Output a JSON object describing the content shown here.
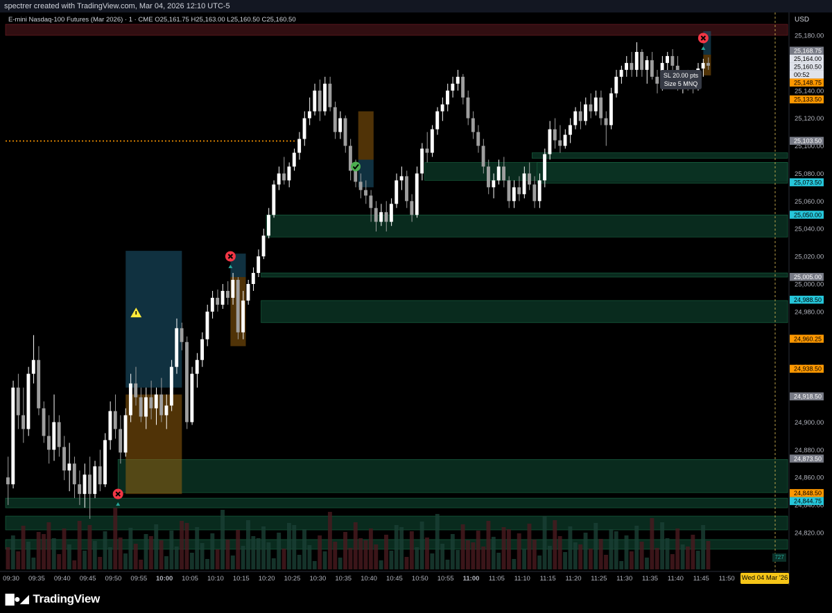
{
  "header": {
    "credit": "spectrer created with TradingView.com, Mar 04, 2026 12:10 UTC-5"
  },
  "symbol": {
    "name": "E-mini Nasdaq-100 Futures (Mar 2026) · 1 · CME",
    "open_label": "O",
    "open": "25,161.75",
    "high_label": "H",
    "high": "25,163.00",
    "low_label": "L",
    "low": "25,160.50",
    "close_label": "C",
    "close": "25,160.50"
  },
  "currency": "USD",
  "footer": {
    "logo": "TradingView",
    "logo_icon": "tradingview-logo-icon"
  },
  "tooltip": {
    "line1": "SL 20.00 pts",
    "line2": "Size 5 MNQ"
  },
  "date_badge": "Wed 04 Mar '26",
  "volume_badge": "727",
  "colors": {
    "up": "#ffffff",
    "down": "#9e9e9e",
    "zone_green": "#0d3b2a",
    "orange": "#ff9800",
    "cyan": "#26c6da",
    "red_marker": "#f23645",
    "green_marker": "#4caf50",
    "warning": "#ffeb3b"
  },
  "chart_data": {
    "type": "candlestick",
    "title": "E-mini Nasdaq-100 Futures (Mar 2026) · 1 · CME",
    "interval": "1 minute",
    "ylim": [
      24810,
      25190
    ],
    "y_ticks": [
      24820,
      24840,
      24860,
      24880,
      24900,
      24920,
      24940,
      24960,
      24980,
      25000,
      25020,
      25040,
      25060,
      25080,
      25100,
      25120,
      25140,
      25160,
      25180
    ],
    "y_tick_labels": [
      "24,820.00",
      "24,840.00",
      "24,860.00",
      "24,880.00",
      "24,900.00",
      "24,920.00",
      "24,940.00",
      "24,960.00",
      "24,980.00",
      "25,000.00",
      "25,020.00",
      "25,040.00",
      "25,060.00",
      "25,080.00",
      "25,100.00",
      "25,120.00",
      "25,140.00",
      "25,160.00",
      "25,180.00"
    ],
    "x_ticks": [
      "09:30",
      "09:35",
      "09:40",
      "09:45",
      "09:50",
      "09:55",
      "10:00",
      "10:05",
      "10:10",
      "10:15",
      "10:20",
      "10:25",
      "10:30",
      "10:35",
      "10:40",
      "10:45",
      "10:50",
      "10:55",
      "11:00",
      "11:05",
      "11:10",
      "11:15",
      "11:20",
      "11:25",
      "11:30",
      "11:35",
      "11:40",
      "11:45",
      "11:50"
    ],
    "bold_x_ticks": [
      "10:00",
      "11:00"
    ],
    "x_range_minutes": [
      0,
      153
    ],
    "price_labels": [
      {
        "text": "25,168.75",
        "value": 25168.75,
        "style": "gray"
      },
      {
        "text": "25,164.00",
        "value": 25164.0,
        "style": "white"
      },
      {
        "text": "25,160.50",
        "value": 25160.5,
        "style": "white"
      },
      {
        "text": "00:52",
        "value": 25156.0,
        "style": "white"
      },
      {
        "text": "25,148.75",
        "value": 25148.75,
        "style": "orange"
      },
      {
        "text": "25,133.50",
        "value": 25133.5,
        "style": "orange"
      },
      {
        "text": "25,103.50",
        "value": 25103.5,
        "style": "gray"
      },
      {
        "text": "25,073.50",
        "value": 25073.5,
        "style": "cyan"
      },
      {
        "text": "25,050.00",
        "value": 25050.0,
        "style": "cyan"
      },
      {
        "text": "25,005.00",
        "value": 25005.0,
        "style": "gray"
      },
      {
        "text": "24,988.50",
        "value": 24988.5,
        "style": "cyan"
      },
      {
        "text": "24,960.25",
        "value": 24960.25,
        "style": "orange"
      },
      {
        "text": "24,938.50",
        "value": 24938.5,
        "style": "orange"
      },
      {
        "text": "24,918.50",
        "value": 24918.5,
        "style": "gray"
      },
      {
        "text": "24,873.50",
        "value": 24873.5,
        "style": "gray"
      },
      {
        "text": "24,848.50",
        "value": 24848.5,
        "style": "orange"
      },
      {
        "text": "24,844.75",
        "value": 24844.75,
        "style": "cyan"
      }
    ],
    "dotted_line_value": 25103.5,
    "zones": [
      {
        "t0": 0,
        "t1": 153,
        "y0": 25180,
        "y1": 25188,
        "kind": "red"
      },
      {
        "t0": 82,
        "t1": 153,
        "y0": 25075,
        "y1": 25088,
        "kind": "green"
      },
      {
        "t0": 103,
        "t1": 153,
        "y0": 25091,
        "y1": 25095,
        "kind": "green"
      },
      {
        "t0": 104,
        "t1": 153,
        "y0": 25073,
        "y1": 25088,
        "kind": "green"
      },
      {
        "t0": 51,
        "t1": 153,
        "y0": 25034,
        "y1": 25050,
        "kind": "green"
      },
      {
        "t0": 50,
        "t1": 153,
        "y0": 25005,
        "y1": 25008,
        "kind": "green"
      },
      {
        "t0": 50,
        "t1": 153,
        "y0": 24972,
        "y1": 24988,
        "kind": "green"
      },
      {
        "t0": 22,
        "t1": 153,
        "y0": 24849,
        "y1": 24873,
        "kind": "green"
      },
      {
        "t0": 0,
        "t1": 153,
        "y0": 24838,
        "y1": 24845,
        "kind": "green"
      },
      {
        "t0": 0,
        "t1": 153,
        "y0": 24822,
        "y1": 24832,
        "kind": "green"
      },
      {
        "t0": 0,
        "t1": 153,
        "y0": 24808,
        "y1": 24815,
        "kind": "green"
      }
    ],
    "positions": [
      {
        "t0": 23.5,
        "t1": 34.5,
        "target_top": 25024,
        "target_bottom": 24925,
        "stop_top": 24920,
        "stop_bottom": 24848,
        "entry_marker": "warning"
      },
      {
        "t0": 44,
        "t1": 47,
        "target_top": 25022,
        "target_bottom": 25005,
        "stop_top": 25005,
        "stop_bottom": 24955
      },
      {
        "t0": 69,
        "t1": 72,
        "target_top": 25090,
        "target_bottom": 25070,
        "stop_top": 25125,
        "stop_bottom": 25090
      },
      {
        "t0": 136.5,
        "t1": 138,
        "target_top": 25183,
        "target_bottom": 25166,
        "stop_top": 25166,
        "stop_bottom": 25151
      }
    ],
    "markers": [
      {
        "t": 22,
        "value": 24848,
        "type": "x"
      },
      {
        "t": 44,
        "value": 25020,
        "type": "x"
      },
      {
        "t": 68.5,
        "value": 25085,
        "type": "check"
      },
      {
        "t": 136.5,
        "value": 25178,
        "type": "x"
      }
    ],
    "volume_max": 700,
    "candles": [
      [
        24860,
        24875,
        24840,
        24855
      ],
      [
        24855,
        24930,
        24852,
        24925
      ],
      [
        24925,
        24935,
        24895,
        24905
      ],
      [
        24905,
        24925,
        24885,
        24895
      ],
      [
        24895,
        24940,
        24890,
        24935
      ],
      [
        24935,
        24963,
        24928,
        24945
      ],
      [
        24945,
        24955,
        24905,
        24910
      ],
      [
        24910,
        24915,
        24885,
        24890
      ],
      [
        24890,
        24905,
        24870,
        24880
      ],
      [
        24880,
        24920,
        24872,
        24900
      ],
      [
        24900,
        24905,
        24875,
        24882
      ],
      [
        24882,
        24890,
        24858,
        24865
      ],
      [
        24865,
        24885,
        24850,
        24870
      ],
      [
        24870,
        24875,
        24845,
        24855
      ],
      [
        24855,
        24865,
        24840,
        24848
      ],
      [
        24848,
        24870,
        24838,
        24862
      ],
      [
        24862,
        24875,
        24830,
        24848
      ],
      [
        24848,
        24872,
        24845,
        24868
      ],
      [
        24868,
        24880,
        24850,
        24855
      ],
      [
        24855,
        24892,
        24853,
        24887
      ],
      [
        24887,
        24915,
        24880,
        24908
      ],
      [
        24908,
        24920,
        24888,
        24895
      ],
      [
        24895,
        24905,
        24870,
        24878
      ],
      [
        24878,
        24910,
        24875,
        24905
      ],
      [
        24905,
        24935,
        24900,
        24928
      ],
      [
        24928,
        24940,
        24912,
        24918
      ],
      [
        24918,
        24925,
        24900,
        24904
      ],
      [
        24904,
        24925,
        24895,
        24918
      ],
      [
        24918,
        24930,
        24902,
        24910
      ],
      [
        24910,
        24925,
        24898,
        24920
      ],
      [
        24920,
        24932,
        24900,
        24905
      ],
      [
        24905,
        24920,
        24895,
        24912
      ],
      [
        24912,
        24945,
        24908,
        24940
      ],
      [
        24940,
        24975,
        24935,
        24968
      ],
      [
        24968,
        24972,
        24952,
        24958
      ],
      [
        24958,
        24962,
        24895,
        24900
      ],
      [
        24900,
        24940,
        24898,
        24935
      ],
      [
        24935,
        24950,
        24925,
        24945
      ],
      [
        24945,
        24965,
        24940,
        24960
      ],
      [
        24960,
        24985,
        24955,
        24980
      ],
      [
        24980,
        24995,
        24975,
        24990
      ],
      [
        24990,
        24996,
        24980,
        24985
      ],
      [
        24985,
        25000,
        24982,
        24995
      ],
      [
        24995,
        25002,
        24985,
        24990
      ],
      [
        24990,
        25008,
        24985,
        25003
      ],
      [
        25003,
        25005,
        24960,
        24965
      ],
      [
        24965,
        24995,
        24960,
        24988
      ],
      [
        24988,
        25003,
        24985,
        25000
      ],
      [
        25000,
        25012,
        24995,
        25008
      ],
      [
        25008,
        25025,
        25005,
        25020
      ],
      [
        25020,
        25040,
        25018,
        25035
      ],
      [
        25035,
        25055,
        25033,
        25050
      ],
      [
        25050,
        25075,
        25048,
        25072
      ],
      [
        25072,
        25085,
        25068,
        25080
      ],
      [
        25080,
        25092,
        25072,
        25075
      ],
      [
        25075,
        25088,
        25070,
        25085
      ],
      [
        25085,
        25098,
        25082,
        25095
      ],
      [
        25095,
        25110,
        25090,
        25105
      ],
      [
        25105,
        25125,
        25100,
        25120
      ],
      [
        25120,
        25135,
        25115,
        25125
      ],
      [
        25125,
        25145,
        25122,
        25140
      ],
      [
        25140,
        25148,
        25118,
        25125
      ],
      [
        25125,
        25150,
        25122,
        25145
      ],
      [
        25145,
        25150,
        25125,
        25128
      ],
      [
        25128,
        25132,
        25105,
        25110
      ],
      [
        25110,
        25125,
        25105,
        25120
      ],
      [
        25120,
        25122,
        25095,
        25100
      ],
      [
        25100,
        25105,
        25075,
        25082
      ],
      [
        25082,
        25090,
        25070,
        25074
      ],
      [
        25074,
        25080,
        25062,
        25068
      ],
      [
        25068,
        25075,
        25058,
        25064
      ],
      [
        25064,
        25068,
        25045,
        25055
      ],
      [
        25055,
        25060,
        25038,
        25045
      ],
      [
        25045,
        25058,
        25042,
        25052
      ],
      [
        25052,
        25060,
        25038,
        25045
      ],
      [
        25045,
        25062,
        25042,
        25058
      ],
      [
        25058,
        25080,
        25055,
        25075
      ],
      [
        25075,
        25085,
        25068,
        25078
      ],
      [
        25078,
        25082,
        25055,
        25060
      ],
      [
        25060,
        25065,
        25045,
        25050
      ],
      [
        25050,
        25085,
        25048,
        25080
      ],
      [
        25080,
        25102,
        25075,
        25098
      ],
      [
        25098,
        25110,
        25088,
        25095
      ],
      [
        25095,
        25115,
        25092,
        25112
      ],
      [
        25112,
        25128,
        25108,
        25125
      ],
      [
        25125,
        25135,
        25118,
        25130
      ],
      [
        25130,
        25145,
        25125,
        25140
      ],
      [
        25140,
        25150,
        25135,
        25145
      ],
      [
        25145,
        25155,
        25140,
        25150
      ],
      [
        25150,
        25152,
        25130,
        25135
      ],
      [
        25135,
        25140,
        25115,
        25120
      ],
      [
        25120,
        25125,
        25105,
        25110
      ],
      [
        25110,
        25115,
        25095,
        25100
      ],
      [
        25100,
        25105,
        25080,
        25085
      ],
      [
        25085,
        25090,
        25065,
        25070
      ],
      [
        25070,
        25080,
        25062,
        25075
      ],
      [
        25075,
        25090,
        25072,
        25085
      ],
      [
        25085,
        25092,
        25070,
        25075
      ],
      [
        25075,
        25078,
        25055,
        25060
      ],
      [
        25060,
        25075,
        25055,
        25070
      ],
      [
        25070,
        25078,
        25060,
        25065
      ],
      [
        25065,
        25085,
        25062,
        25080
      ],
      [
        25080,
        25088,
        25068,
        25072
      ],
      [
        25072,
        25078,
        25055,
        25060
      ],
      [
        25060,
        25080,
        25055,
        25075
      ],
      [
        25075,
        25098,
        25070,
        25094
      ],
      [
        25094,
        25118,
        25090,
        25112
      ],
      [
        25112,
        25120,
        25098,
        25104
      ],
      [
        25104,
        25115,
        25095,
        25100
      ],
      [
        25100,
        25112,
        25098,
        25108
      ],
      [
        25108,
        25120,
        25102,
        25115
      ],
      [
        25115,
        25128,
        25112,
        25125
      ],
      [
        25125,
        25132,
        25112,
        25118
      ],
      [
        25118,
        25135,
        25115,
        25130
      ],
      [
        25130,
        25138,
        25120,
        25125
      ],
      [
        25125,
        25140,
        25122,
        25135
      ],
      [
        25135,
        25140,
        25115,
        25120
      ],
      [
        25120,
        25125,
        25100,
        25115
      ],
      [
        25115,
        25142,
        25112,
        25138
      ],
      [
        25138,
        25155,
        25135,
        25150
      ],
      [
        25150,
        25158,
        25145,
        25155
      ],
      [
        25155,
        25165,
        25150,
        25160
      ],
      [
        25160,
        25168,
        25150,
        25155
      ],
      [
        25155,
        25175,
        25150,
        25168
      ],
      [
        25168,
        25170,
        25150,
        25155
      ],
      [
        25155,
        25165,
        25145,
        25162
      ],
      [
        25162,
        25168,
        25148,
        25150
      ],
      [
        25150,
        25155,
        25138,
        25145
      ],
      [
        25145,
        25165,
        25140,
        25160
      ],
      [
        25160,
        25168,
        25150,
        25165
      ],
      [
        25165,
        25170,
        25155,
        25158
      ],
      [
        25158,
        25165,
        25140,
        25145
      ],
      [
        25145,
        25152,
        25138,
        25150
      ],
      [
        25150,
        25155,
        25140,
        25148
      ],
      [
        25148,
        25155,
        25138,
        25144
      ],
      [
        25144,
        25160,
        25140,
        25156
      ],
      [
        25156,
        25163,
        25150,
        25160
      ],
      [
        25160,
        25164,
        25155,
        25158
      ]
    ]
  }
}
